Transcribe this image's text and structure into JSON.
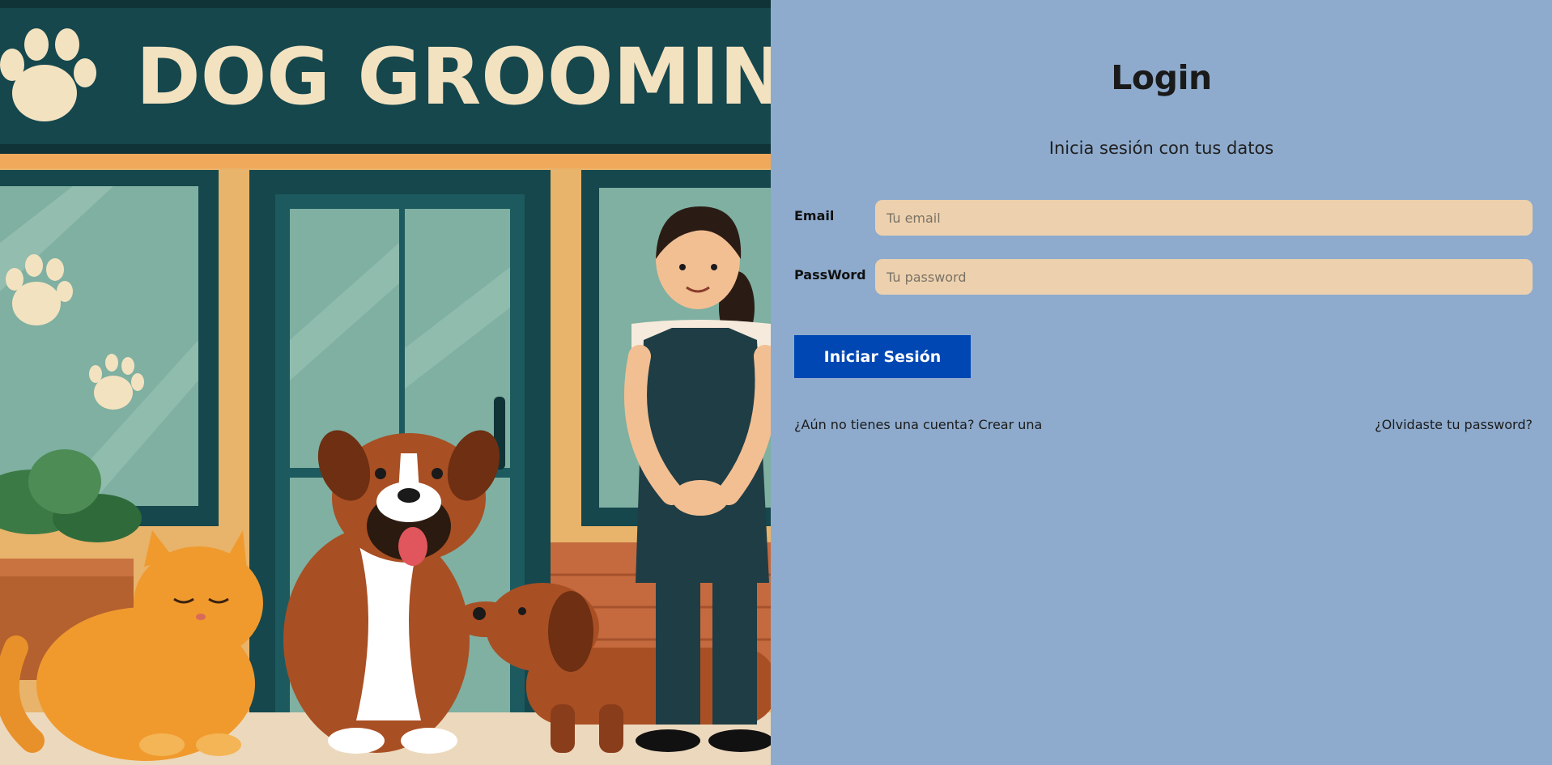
{
  "illustration": {
    "sign_text": "DOG GROOMING"
  },
  "login": {
    "title": "Login",
    "subtitle": "Inicia sesión con tus datos",
    "email_label": "Email",
    "email_placeholder": "Tu email",
    "email_value": "",
    "password_label": "PassWord",
    "password_placeholder": "Tu password",
    "password_value": "",
    "submit_label": "Iniciar Sesión",
    "register_link": "¿Aún no tienes una cuenta? Crear una",
    "forgot_link": "¿Olvidaste tu password?"
  },
  "colors": {
    "panel_bg": "#8eabcd",
    "input_bg": "#edd1ae",
    "button_bg": "#0047b3",
    "sign_bg": "#15474d"
  }
}
